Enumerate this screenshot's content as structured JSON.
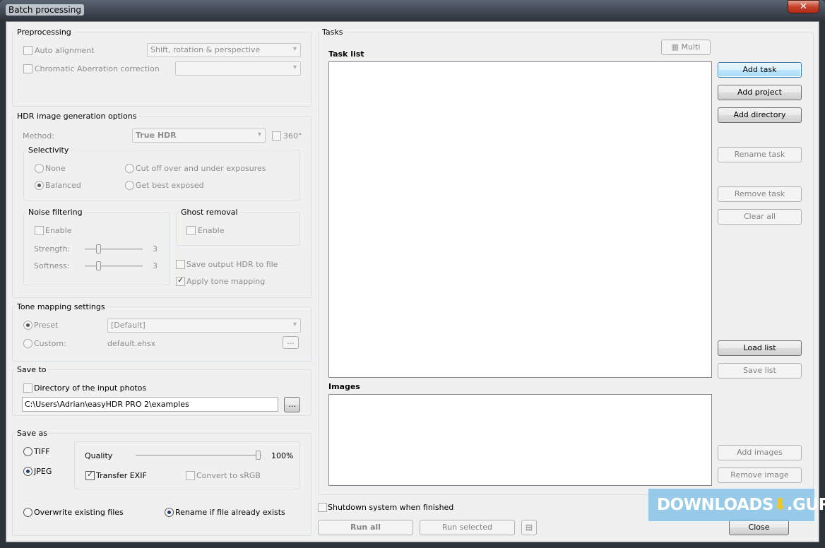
{
  "window": {
    "title": "Batch processing",
    "close_glyph": "✕"
  },
  "preprocessing": {
    "title": "Preprocessing",
    "auto_alignment": {
      "label": "Auto alignment",
      "checked": false,
      "value": "Shift, rotation & perspective"
    },
    "chromatic": {
      "label": "Chromatic Aberration correction",
      "checked": false,
      "value": ""
    }
  },
  "hdr": {
    "title": "HDR image generation options",
    "method_label": "Method:",
    "method_value": "True HDR",
    "pano_label": "360°",
    "selectivity": {
      "title": "Selectivity",
      "none": "None",
      "cut": "Cut off over and under exposures",
      "balanced": "Balanced",
      "best": "Get best exposed",
      "selected": "Balanced"
    },
    "noise": {
      "title": "Noise filtering",
      "enable": "Enable",
      "strength_label": "Strength:",
      "strength_value": "3",
      "softness_label": "Softness:",
      "softness_value": "3"
    },
    "ghost": {
      "title": "Ghost removal",
      "enable": "Enable"
    },
    "save_hdr": "Save output HDR to file",
    "apply_tm": "Apply tone mapping",
    "apply_tm_checked": true
  },
  "tone": {
    "title": "Tone mapping settings",
    "preset_label": "Preset",
    "preset_value": "[Default]",
    "custom_label": "Custom:",
    "custom_value": "default.ehsx",
    "browse": "..."
  },
  "save_to": {
    "title": "Save to",
    "dir_input": "Directory of the input photos",
    "path": "C:\\Users\\Adrian\\easyHDR PRO 2\\examples",
    "browse": "..."
  },
  "save_as": {
    "title": "Save as",
    "tiff": "TIFF",
    "jpeg": "JPEG",
    "selected": "JPEG",
    "quality_label": "Quality",
    "quality_value": "100%",
    "quality": 100,
    "exif": "Transfer EXIF",
    "exif_checked": true,
    "srgb": "Convert to sRGB",
    "overwrite": "Overwrite existing files",
    "rename": "Rename if file already exists",
    "collision": "Rename if file already exists"
  },
  "tasks": {
    "title": "Tasks",
    "multi": "Multi",
    "task_list": "Task list",
    "images": "Images",
    "buttons": {
      "add_task": "Add task",
      "add_project": "Add project",
      "add_directory": "Add directory",
      "rename_task": "Rename task",
      "remove_task": "Remove task",
      "clear_all": "Clear all",
      "load_list": "Load list",
      "save_list": "Save list",
      "add_images": "Add images",
      "remove_image": "Remove image"
    }
  },
  "footer": {
    "shutdown": "Shutdown system when finished",
    "run_all": "Run all",
    "run_selected": "Run selected",
    "close": "Close"
  },
  "watermark": {
    "text": "DOWNLOADS",
    "suffix": ".GURU"
  }
}
